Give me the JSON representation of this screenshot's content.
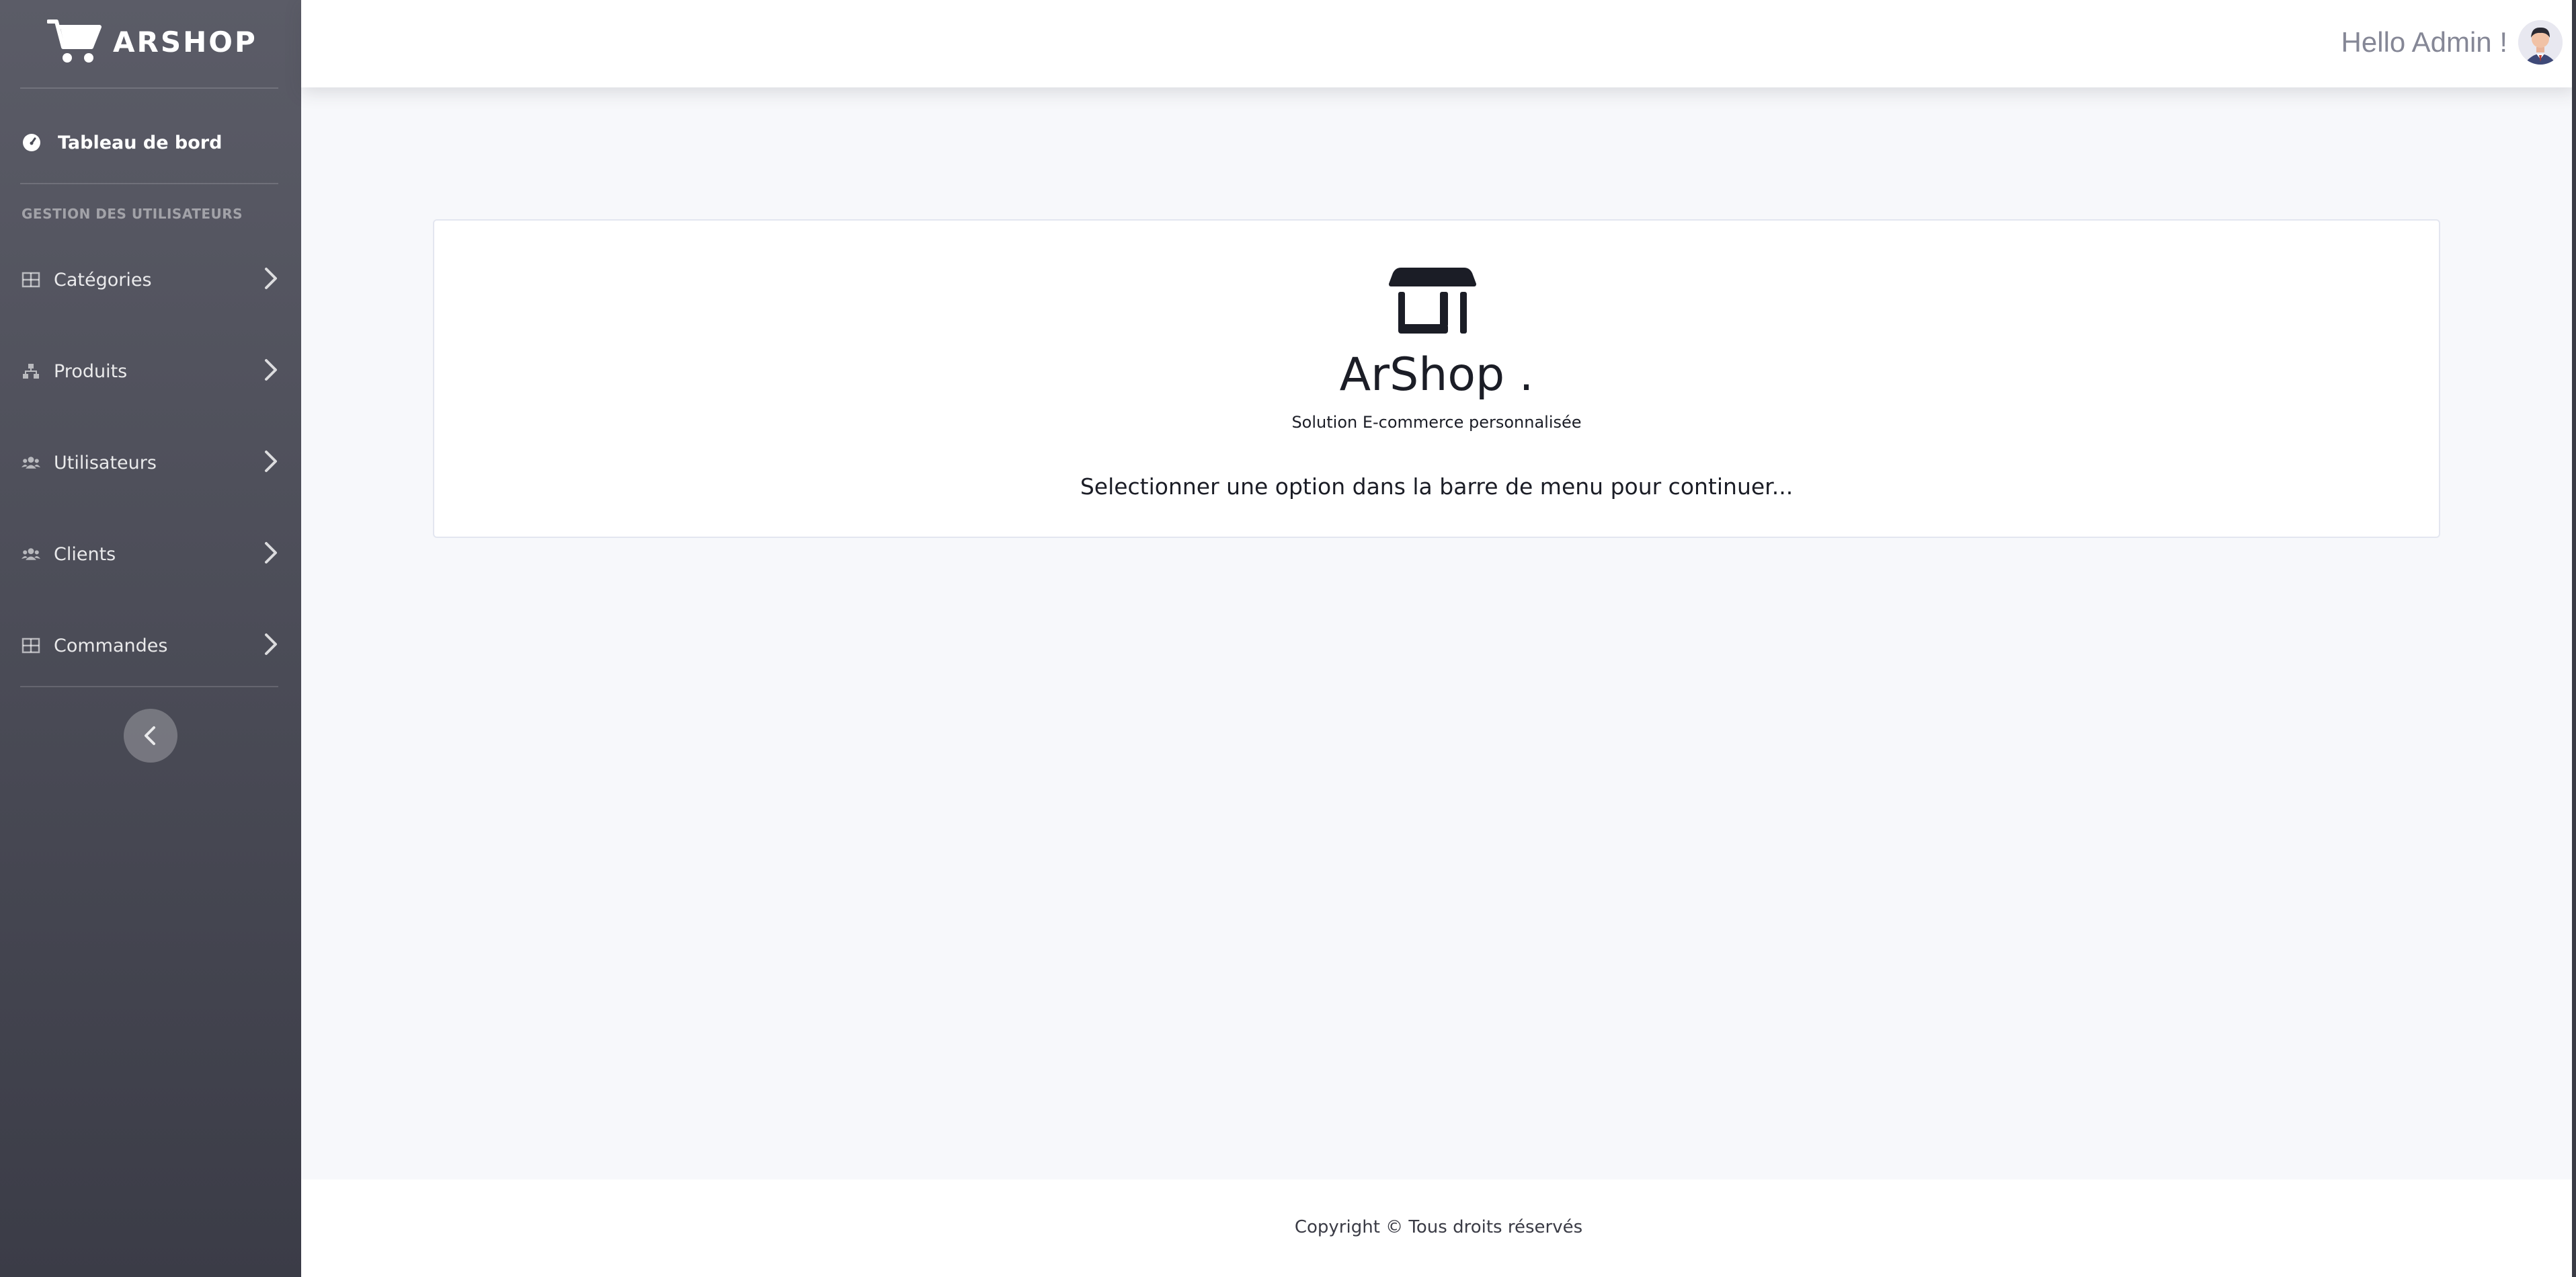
{
  "brand": {
    "name": "ARSHOP",
    "icon": "shopping-cart-icon"
  },
  "sidebar": {
    "dashboard": {
      "label": "Tableau de bord",
      "icon": "tachometer-icon"
    },
    "section_heading": "GESTION DES UTILISATEURS",
    "items": [
      {
        "label": "Catégories",
        "icon": "table-grid-icon"
      },
      {
        "label": "Produits",
        "icon": "sitemap-icon"
      },
      {
        "label": "Utilisateurs",
        "icon": "users-icon"
      },
      {
        "label": "Clients",
        "icon": "users-icon"
      },
      {
        "label": "Commandes",
        "icon": "table-grid-icon"
      }
    ],
    "collapse_icon": "chevron-left-icon"
  },
  "topbar": {
    "greeting": "Hello Admin !",
    "avatar_icon": "user-avatar-icon"
  },
  "card": {
    "icon": "store-icon",
    "title": "ArShop .",
    "subtitle": "Solution E-commerce personnalisée",
    "message": "Selectionner une option dans la barre de menu pour continuer..."
  },
  "footer": {
    "text": "Copyright © Tous droits réservés"
  },
  "colors": {
    "sidebar_top": "#5b5c67",
    "sidebar_bottom": "#3b3c47",
    "background": "#f7f8fb",
    "text_dark": "#1b1d26",
    "greeting": "#858796"
  }
}
